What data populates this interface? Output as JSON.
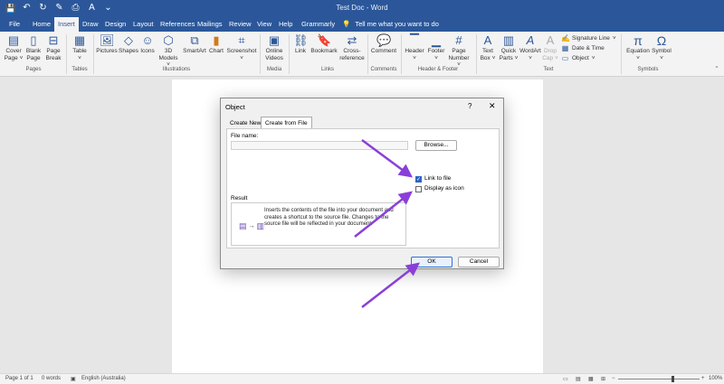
{
  "titlebar": {
    "doc_title": "Test Doc - Word",
    "qat": [
      {
        "icon": "save-icon",
        "glyph": "💾"
      },
      {
        "icon": "undo-icon",
        "glyph": "↶"
      },
      {
        "icon": "redo-icon",
        "glyph": "↻"
      },
      {
        "icon": "format-painter-icon",
        "glyph": "✎"
      },
      {
        "icon": "print-preview-icon",
        "glyph": "⎙"
      },
      {
        "icon": "spelling-icon",
        "glyph": "A"
      },
      {
        "icon": "customize-qat-icon",
        "glyph": "⌄"
      }
    ]
  },
  "tabs": [
    "File",
    "Home",
    "Insert",
    "Draw",
    "Design",
    "Layout",
    "References",
    "Mailings",
    "Review",
    "View",
    "Help",
    "Grammarly"
  ],
  "active_tab": "Insert",
  "tellme": "Tell me what you want to do",
  "ribbon": {
    "groups": {
      "pages": "Pages",
      "tables": "Tables",
      "illustrations": "Illustrations",
      "media": "Media",
      "links": "Links",
      "comments": "Comments",
      "header_footer": "Header & Footer",
      "text": "Text",
      "symbols": "Symbols"
    },
    "buttons": {
      "cover_page": [
        "Cover",
        "Page ˅"
      ],
      "blank_page": [
        "Blank",
        "Page"
      ],
      "page_break": [
        "Page",
        "Break"
      ],
      "table": [
        "Table",
        "˅"
      ],
      "pictures": [
        "Pictures",
        ""
      ],
      "shapes": [
        "Shapes",
        ""
      ],
      "icons": [
        "Icons",
        ""
      ],
      "models3d": [
        "3D",
        "Models ˅"
      ],
      "smartart": [
        "SmartArt",
        ""
      ],
      "chart": [
        "Chart",
        ""
      ],
      "screenshot": [
        "Screenshot",
        "˅"
      ],
      "online_videos": [
        "Online",
        "Videos"
      ],
      "link": [
        "Link",
        ""
      ],
      "bookmark": [
        "Bookmark",
        ""
      ],
      "cross_reference": [
        "Cross-",
        "reference"
      ],
      "comment": [
        "Comment",
        ""
      ],
      "header": [
        "Header",
        "˅"
      ],
      "footer": [
        "Footer",
        "˅"
      ],
      "page_number": [
        "Page",
        "Number ˅"
      ],
      "text_box": [
        "Text",
        "Box ˅"
      ],
      "quick_parts": [
        "Quick",
        "Parts ˅"
      ],
      "wordart": [
        "WordArt",
        "˅"
      ],
      "drop_cap": [
        "Drop",
        "Cap ˅"
      ],
      "equation": [
        "Equation",
        "˅"
      ],
      "symbol": [
        "Symbol",
        "˅"
      ]
    },
    "text_small": {
      "signature_line": "Signature Line",
      "date_time": "Date & Time",
      "object": "Object"
    }
  },
  "dialog": {
    "title": "Object",
    "help": "?",
    "close": "✕",
    "tabs": [
      "Create New",
      "Create from File"
    ],
    "file_name_label": "File name:",
    "browse": "Browse...",
    "link_to_file": "Link to file",
    "display_as_icon": "Display as icon",
    "link_checked": true,
    "icon_checked": false,
    "result_label": "Result",
    "result_text": "Inserts the contents of the file into your document and creates a shortcut to the source file. Changes to the source file will be reflected in your document.",
    "ok": "OK",
    "cancel": "Cancel"
  },
  "statusbar": {
    "page": "Page 1 of 1",
    "words": "0 words",
    "language": "English (Australia)",
    "zoom": "100%"
  },
  "colors": {
    "word_blue": "#2b579a",
    "arrow": "#8b3fd9"
  }
}
